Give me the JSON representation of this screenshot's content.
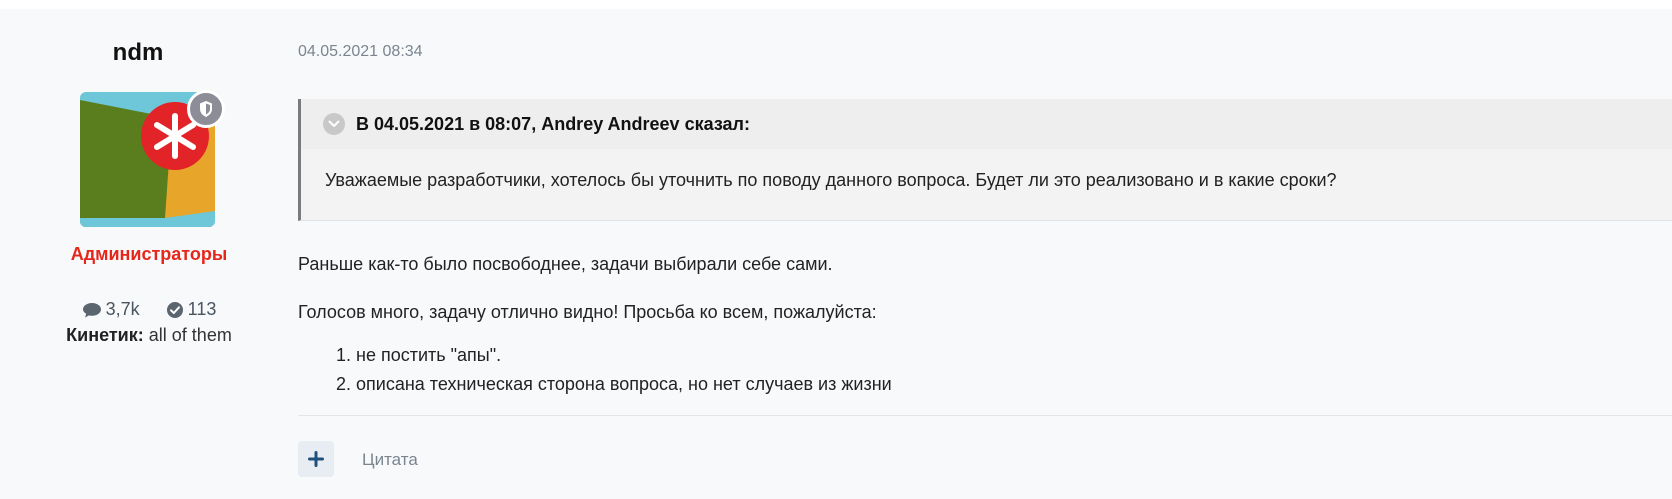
{
  "author": {
    "username": "ndm",
    "group": "Администраторы",
    "stats": {
      "comments": "3,7k",
      "solutions": "113"
    },
    "kinetic_label": "Кинетик:",
    "kinetic_value": "all of them",
    "avatar_icon": "asterisk-logo-icon",
    "badge_icon": "shield-icon"
  },
  "post": {
    "date": "04.05.2021 08:34",
    "quote": {
      "header": "В 04.05.2021 в 08:07, Andrey Andreev сказал:",
      "body": "Уважаемые разработчики, хотелось бы уточнить по поводу данного вопроса. Будет ли это реализовано и в какие сроки?"
    },
    "paragraphs": [
      "Раньше как-то было посвободнее, задачи выбирали себе сами.",
      "Голосов много, задачу отлично видно! Просьба ко всем, пожалуйста:"
    ],
    "list": [
      "1. не постить \"апы\".",
      "2. описана техническая сторона вопроса, но нет случаев из жизни"
    ]
  },
  "actions": {
    "plus_icon": "plus-icon",
    "quote_label": "Цитата"
  },
  "colors": {
    "group": "#e6261b",
    "muted": "#7a8590",
    "quote_border": "#7b7b7b"
  }
}
